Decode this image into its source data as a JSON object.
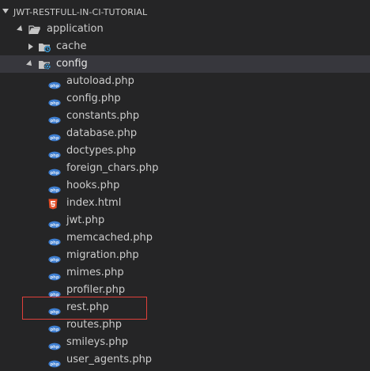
{
  "explorer": {
    "title": "JWT-RESTFULL-IN-CI-TUTORIAL",
    "folders": {
      "application": "application",
      "cache": "cache",
      "config": "config"
    },
    "files": [
      {
        "name": "autoload.php",
        "type": "php"
      },
      {
        "name": "config.php",
        "type": "php"
      },
      {
        "name": "constants.php",
        "type": "php"
      },
      {
        "name": "database.php",
        "type": "php"
      },
      {
        "name": "doctypes.php",
        "type": "php"
      },
      {
        "name": "foreign_chars.php",
        "type": "php"
      },
      {
        "name": "hooks.php",
        "type": "php"
      },
      {
        "name": "index.html",
        "type": "html"
      },
      {
        "name": "jwt.php",
        "type": "php"
      },
      {
        "name": "memcached.php",
        "type": "php"
      },
      {
        "name": "migration.php",
        "type": "php"
      },
      {
        "name": "mimes.php",
        "type": "php"
      },
      {
        "name": "profiler.php",
        "type": "php"
      },
      {
        "name": "rest.php",
        "type": "php"
      },
      {
        "name": "routes.php",
        "type": "php"
      },
      {
        "name": "smileys.php",
        "type": "php"
      },
      {
        "name": "user_agents.php",
        "type": "php"
      }
    ],
    "icons": {
      "php_badge_color": "#3f7fd1",
      "html_icon_color": "#e44d26",
      "folder_color": "#c5c5c5",
      "special_folder_accent": "#3aa3e3"
    }
  }
}
